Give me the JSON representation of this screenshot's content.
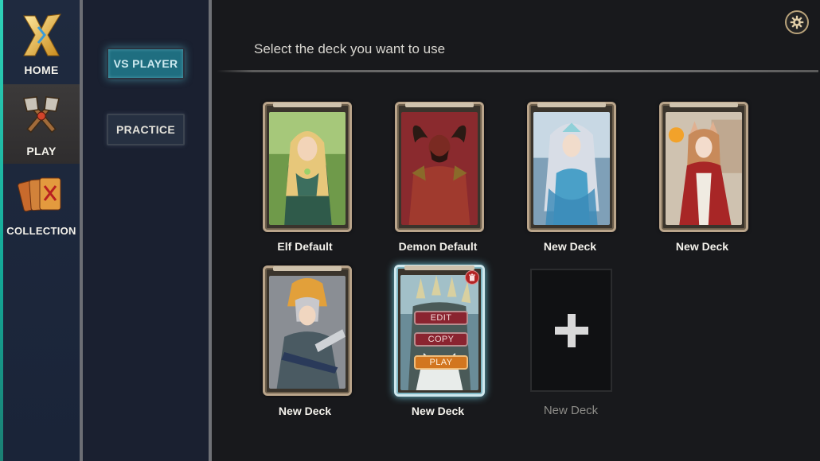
{
  "nav": {
    "items": [
      {
        "label": "HOME",
        "icon": "x-logo-icon"
      },
      {
        "label": "PLAY",
        "icon": "crossed-axes-icon",
        "active": true
      },
      {
        "label": "COLLECTION",
        "icon": "cards-icon"
      }
    ]
  },
  "modes": {
    "vs_player": "VS PLAYER",
    "practice": "PRACTICE",
    "selected": "VS PLAYER"
  },
  "main": {
    "title": "Select the deck you want to use",
    "settings_icon": "gear-icon"
  },
  "decks": [
    {
      "name": "Elf Default",
      "art": "elf-portrait"
    },
    {
      "name": "Demon Default",
      "art": "demon-portrait"
    },
    {
      "name": "New Deck",
      "art": "priestess-portrait"
    },
    {
      "name": "New Deck",
      "art": "fox-mage-portrait"
    },
    {
      "name": "New Deck",
      "art": "knight-portrait"
    },
    {
      "name": "New Deck",
      "art": "dragon-portrait",
      "selected": true
    }
  ],
  "deck_actions": {
    "edit": "EDIT",
    "copy": "COPY",
    "play": "PLAY"
  },
  "new_deck": {
    "label": "New Deck",
    "icon": "plus-icon"
  },
  "colors": {
    "accent_teal": "#2fd1b8",
    "vs_player_bg": "#1f6e80",
    "frame_gold": "#b9a48a",
    "action_red": "#8a2430",
    "action_orange": "#d2761f"
  }
}
